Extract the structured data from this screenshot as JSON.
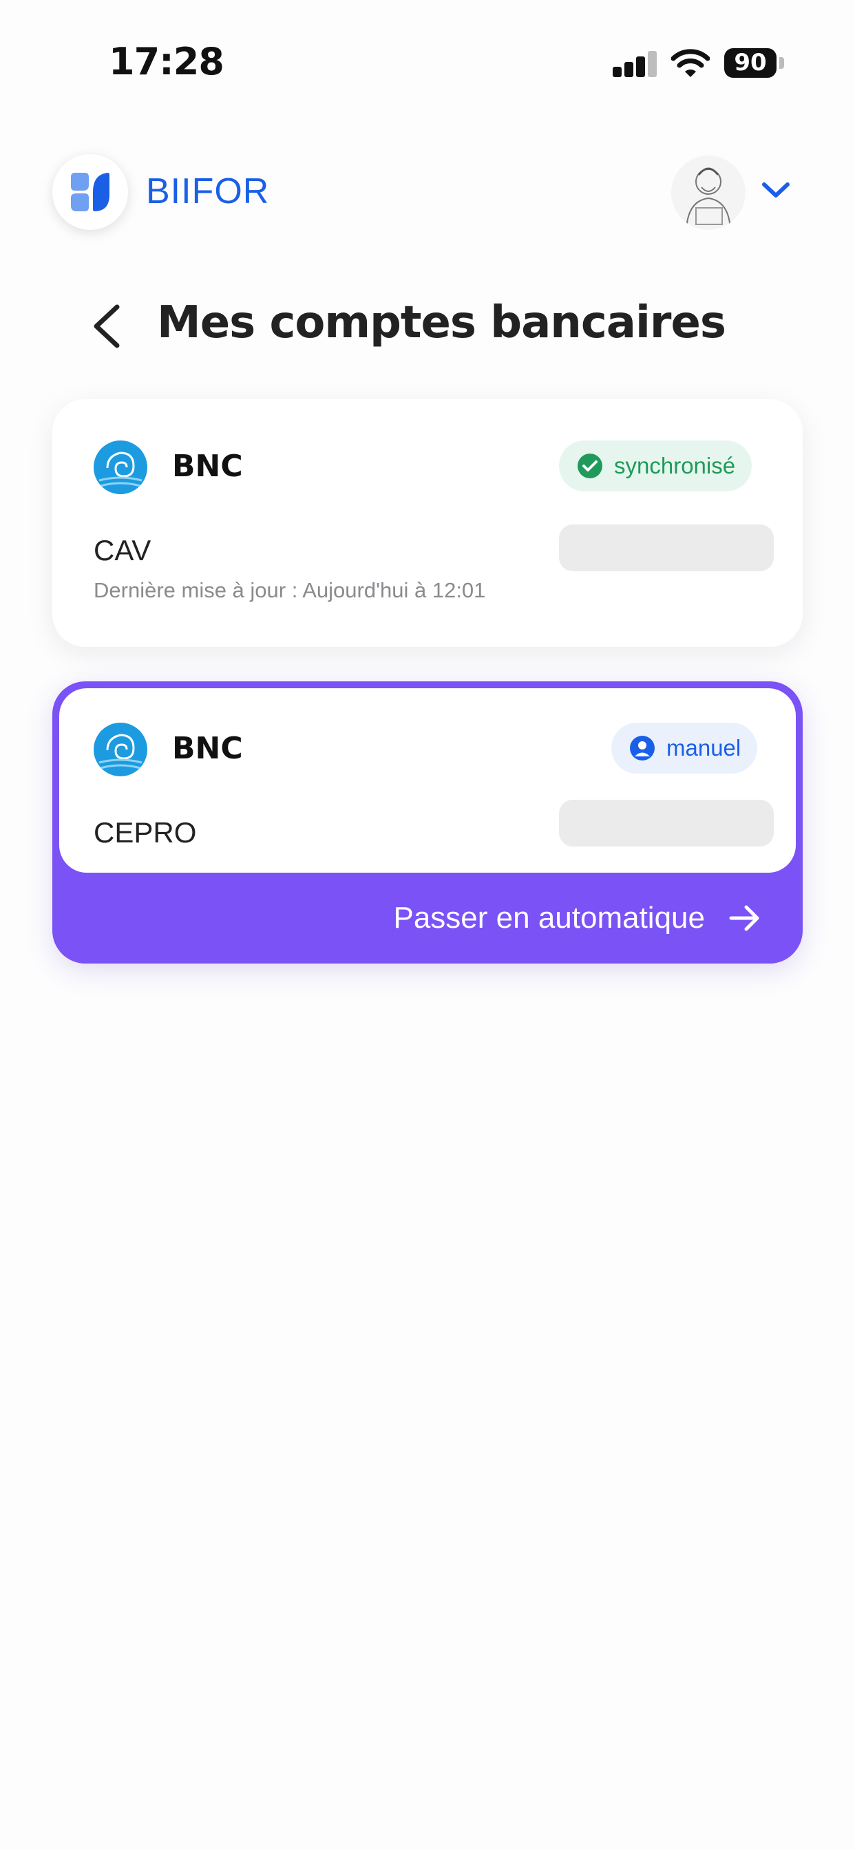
{
  "status_bar": {
    "time": "17:28",
    "battery": "90",
    "icons": [
      "cellular-signal-icon",
      "wifi-icon",
      "battery-icon"
    ]
  },
  "header": {
    "app_name": "BIIFOR",
    "logo_icon": "biifor-logo-icon",
    "avatar": "user-avatar",
    "profile_menu_icon": "chevron-down-icon"
  },
  "page": {
    "title": "Mes comptes bancaires",
    "back_icon": "chevron-left-icon"
  },
  "accounts": [
    {
      "bank": "BNC",
      "account": "CAV",
      "status": "synchronisé",
      "status_icon": "check-circle-icon",
      "status_color": "#1f9a5a",
      "last_update": "Dernière mise à jour : Aujourd'hui à 12:01"
    },
    {
      "bank": "BNC",
      "account": "CEPRO",
      "status": "manuel",
      "status_icon": "user-circle-icon",
      "status_color": "#1b5fe6",
      "action": "Passer en automatique",
      "action_icon": "arrow-right-icon",
      "action_color": "#7b52f5"
    }
  ],
  "colors": {
    "brand_blue": "#1b5fe6",
    "accent_purple": "#7b52f5",
    "bank_blue": "#1d9be0",
    "placeholder_gray": "#ebebeb"
  }
}
